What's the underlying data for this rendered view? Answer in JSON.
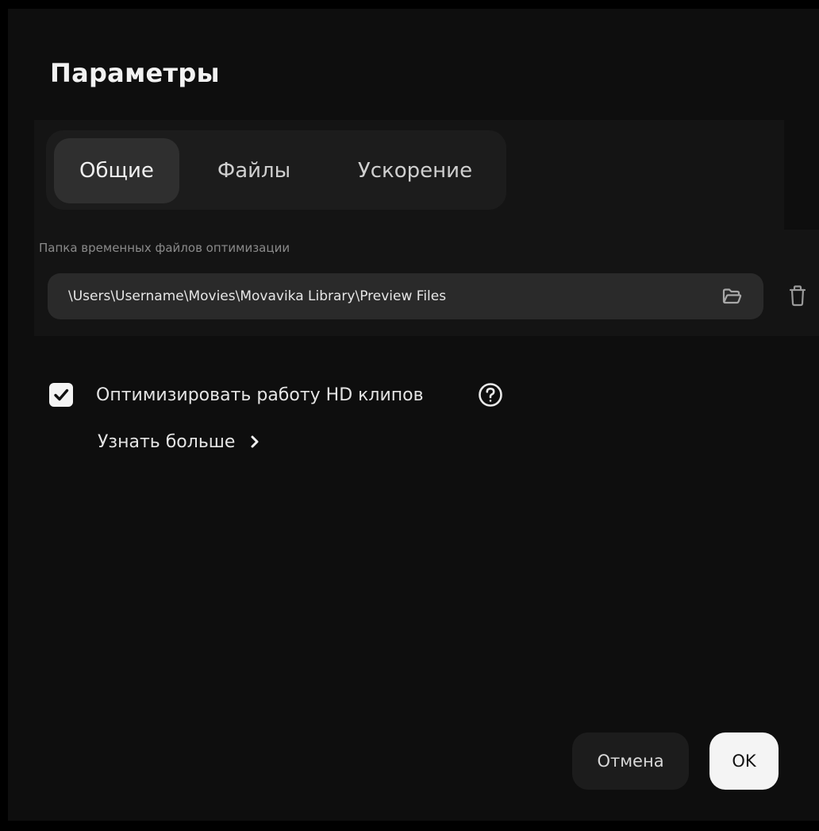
{
  "dialog": {
    "title": "Параметры"
  },
  "tabs": [
    {
      "label": "Общие",
      "active": true
    },
    {
      "label": "Файлы",
      "active": false
    },
    {
      "label": "Ускорение",
      "active": false
    }
  ],
  "temp_folder": {
    "label": "Папка временных файлов оптимизации",
    "value": "\\Users\\Username\\Movies\\Movavika Library\\Preview Files",
    "browse_icon": "folder-icon",
    "delete_icon": "trash-icon"
  },
  "optimize": {
    "checked": true,
    "label": "Оптимизировать работу HD клипов",
    "help_icon": "question-icon",
    "learn_more": "Узнать больше"
  },
  "footer": {
    "cancel_label": "Отмена",
    "ok_label": "OK"
  },
  "colors": {
    "background": "#0e0e0e",
    "panel": "#141414",
    "tab_group": "#1c1c1c",
    "tab_active": "#2f2f2f",
    "field": "#2a2a2a",
    "primary_button": "#f4f4f4"
  }
}
